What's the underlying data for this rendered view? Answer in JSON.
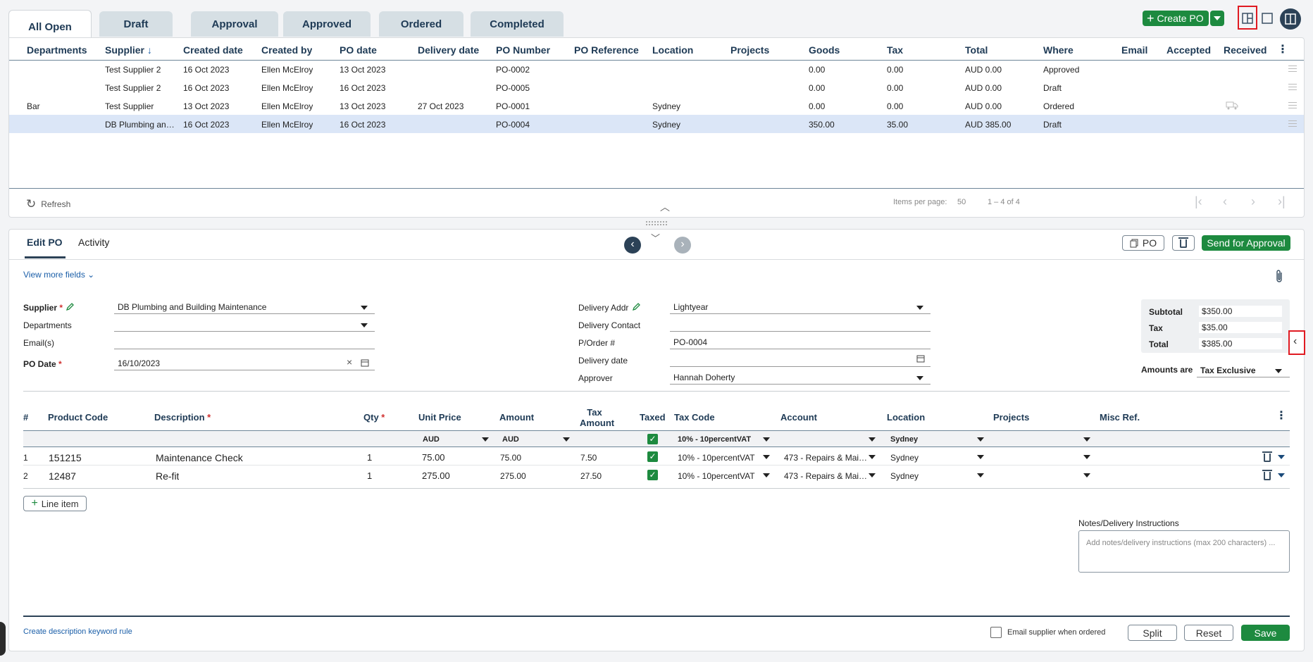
{
  "tabs": [
    "All Open",
    "Draft",
    "Approval",
    "Approved",
    "Ordered",
    "Completed"
  ],
  "toolbar": {
    "create_po": "Create PO"
  },
  "grid": {
    "columns": [
      "Departments",
      "Supplier",
      "Created date",
      "Created by",
      "PO date",
      "Delivery date",
      "PO Number",
      "PO Reference",
      "Location",
      "Projects",
      "Goods",
      "Tax",
      "Total",
      "Where",
      "Email",
      "Accepted",
      "Received"
    ],
    "rows": [
      {
        "departments": "",
        "supplier": "Test Supplier 2",
        "created": "16 Oct 2023",
        "created_by": "Ellen McElroy",
        "po_date": "13 Oct 2023",
        "delivery": "",
        "po_number": "PO-0002",
        "location": "",
        "goods": "0.00",
        "tax": "0.00",
        "total": "AUD 0.00",
        "where": "Approved"
      },
      {
        "departments": "",
        "supplier": "Test Supplier 2",
        "created": "16 Oct 2023",
        "created_by": "Ellen McElroy",
        "po_date": "16 Oct 2023",
        "delivery": "",
        "po_number": "PO-0005",
        "location": "",
        "goods": "0.00",
        "tax": "0.00",
        "total": "AUD 0.00",
        "where": "Draft"
      },
      {
        "departments": "Bar",
        "supplier": "Test Supplier",
        "created": "13 Oct 2023",
        "created_by": "Ellen McElroy",
        "po_date": "13 Oct 2023",
        "delivery": "27 Oct 2023",
        "po_number": "PO-0001",
        "location": "Sydney",
        "goods": "0.00",
        "tax": "0.00",
        "total": "AUD 0.00",
        "where": "Ordered"
      },
      {
        "departments": "",
        "supplier": "DB Plumbing and …",
        "created": "16 Oct 2023",
        "created_by": "Ellen McElroy",
        "po_date": "16 Oct 2023",
        "delivery": "",
        "po_number": "PO-0004",
        "location": "Sydney",
        "goods": "350.00",
        "tax": "35.00",
        "total": "AUD 385.00",
        "where": "Draft"
      }
    ],
    "refresh": "Refresh",
    "items_per_page_label": "Items per page:",
    "items_per_page": "50",
    "range": "1 – 4 of 4"
  },
  "edit": {
    "tab_edit": "Edit PO",
    "tab_activity": "Activity",
    "po_button": "PO",
    "send_for_approval": "Send for Approval",
    "view_more": "View more fields",
    "supplier_label": "Supplier",
    "supplier_value": "DB Plumbing and Building Maintenance",
    "departments_label": "Departments",
    "emails_label": "Email(s)",
    "po_date_label": "PO Date",
    "po_date_value": "16/10/2023",
    "delivery_addr_label": "Delivery Addr",
    "delivery_addr_value": "Lightyear",
    "delivery_contact_label": "Delivery Contact",
    "porder_label": "P/Order #",
    "porder_value": "PO-0004",
    "delivery_date_label": "Delivery date",
    "approver_label": "Approver",
    "approver_value": "Hannah Doherty",
    "subtotal_label": "Subtotal",
    "subtotal_value": "$350.00",
    "tax_label": "Tax",
    "tax_value": "$35.00",
    "total_label": "Total",
    "total_value": "$385.00",
    "amounts_are_label": "Amounts are",
    "amounts_are_value": "Tax Exclusive"
  },
  "lines": {
    "columns": {
      "num": "#",
      "product": "Product Code",
      "description": "Description",
      "qty": "Qty",
      "unit_price": "Unit Price",
      "amount": "Amount",
      "tax_amount_1": "Tax",
      "tax_amount_2": "Amount",
      "taxed": "Taxed",
      "tax_code": "Tax Code",
      "account": "Account",
      "location": "Location",
      "projects": "Projects",
      "misc": "Misc Ref."
    },
    "defaults": {
      "unit_currency": "AUD",
      "amount_currency": "AUD",
      "tax_code": "10% - 10percentVAT",
      "location": "Sydney"
    },
    "rows": [
      {
        "num": "1",
        "product": "151215",
        "description": "Maintenance Check",
        "qty": "1",
        "unit_price": "75.00",
        "amount": "75.00",
        "tax_amount": "7.50",
        "tax_code": "10% - 10percentVAT",
        "account": "473 - Repairs & Main…",
        "location": "Sydney"
      },
      {
        "num": "2",
        "product": "12487",
        "description": "Re-fit",
        "qty": "1",
        "unit_price": "275.00",
        "amount": "275.00",
        "tax_amount": "27.50",
        "tax_code": "10% - 10percentVAT",
        "account": "473 - Repairs & Main…",
        "location": "Sydney"
      }
    ],
    "add_line": "Line item"
  },
  "notes": {
    "label": "Notes/Delivery Instructions",
    "placeholder": "Add notes/delivery instructions (max 200 characters) ..."
  },
  "footer": {
    "keyword_rule": "Create description keyword rule",
    "email_supplier": "Email supplier when ordered",
    "split": "Split",
    "reset": "Reset",
    "save": "Save"
  }
}
